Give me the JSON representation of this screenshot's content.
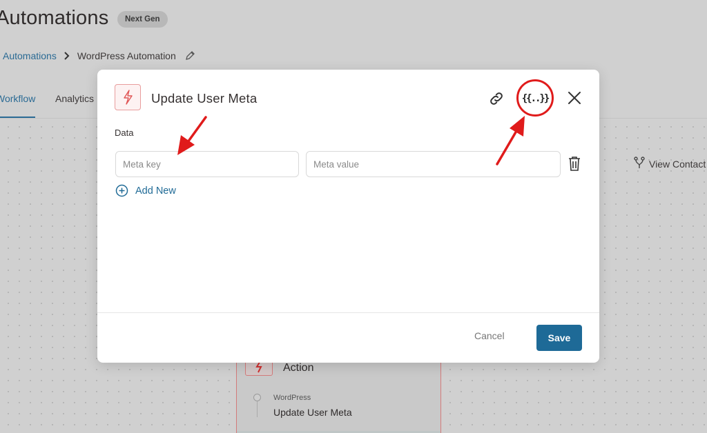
{
  "page": {
    "title": "Automations",
    "badge": "Next Gen",
    "breadcrumb": {
      "root": "Automations",
      "current": "WordPress Automation"
    },
    "tabs": [
      {
        "label": "Workflow"
      },
      {
        "label": "Analytics"
      }
    ],
    "view_contact": "View Contact"
  },
  "node": {
    "title": "Action",
    "category": "WordPress",
    "name": "Update User Meta"
  },
  "modal": {
    "title": "Update User Meta",
    "data_label": "Data",
    "meta_key_placeholder": "Meta key",
    "meta_value_placeholder": "Meta value",
    "merge_tag_glyph": "{{..}}",
    "add_new_label": "Add New",
    "cancel_label": "Cancel",
    "save_label": "Save"
  },
  "colors": {
    "accent": "#1e6a97",
    "action_red": "#e05454",
    "annotation_red": "#e01b1b"
  },
  "icons": {
    "edit": "pencil-icon",
    "link": "link-icon",
    "merge": "merge-tag-icon",
    "close": "close-icon",
    "delete": "trash-icon",
    "add": "plus-circle-icon",
    "action": "lightning-icon",
    "contact": "branch-icon"
  }
}
